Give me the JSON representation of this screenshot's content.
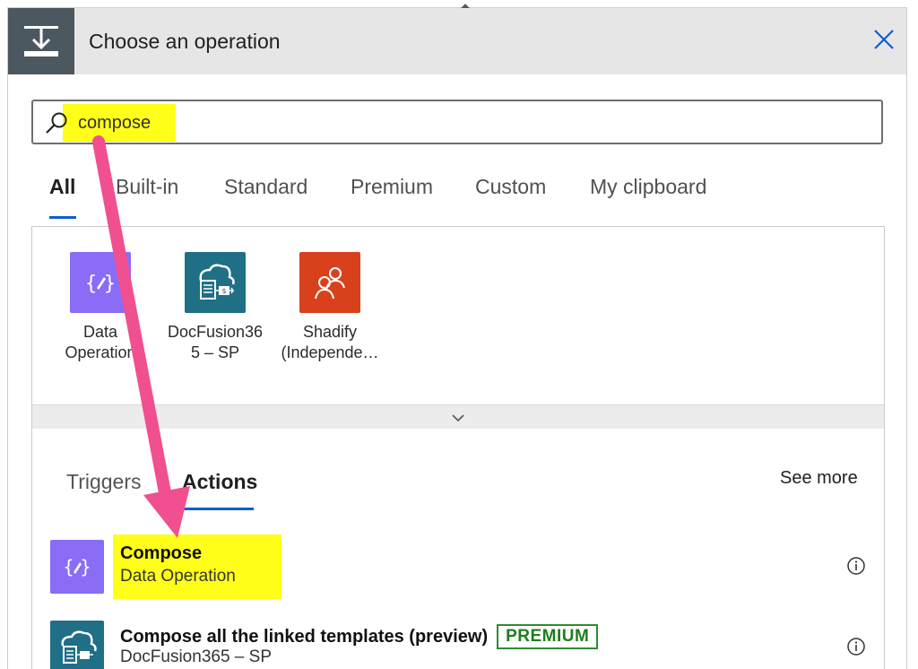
{
  "header": {
    "title": "Choose an operation",
    "close_label": "×"
  },
  "search": {
    "value": "compose",
    "highlight_color": "#ffff1a"
  },
  "tabs": [
    {
      "label": "All",
      "active": true
    },
    {
      "label": "Built-in",
      "active": false
    },
    {
      "label": "Standard",
      "active": false
    },
    {
      "label": "Premium",
      "active": false
    },
    {
      "label": "Custom",
      "active": false
    },
    {
      "label": "My clipboard",
      "active": false
    }
  ],
  "connectors": [
    {
      "line1": "Data",
      "line2": "Operation",
      "color": "#8a6cf7",
      "icon": "curly-pencil-icon"
    },
    {
      "line1": "DocFusion36",
      "line2": "5 – SP",
      "color": "#1f6f87",
      "icon": "cloud-document-icon"
    },
    {
      "line1": "Shadify",
      "line2": "(Independe…",
      "color": "#d9411c",
      "icon": "people-icon"
    }
  ],
  "subtabs": {
    "triggers": "Triggers",
    "actions": "Actions",
    "see_more": "See more"
  },
  "results": [
    {
      "title": "Compose",
      "subtitle": "Data Operation",
      "color": "#8a6cf7",
      "icon": "curly-pencil-icon",
      "premium": false
    },
    {
      "title": "Compose all the linked templates (preview)",
      "subtitle": "DocFusion365 – SP",
      "color": "#1f6f87",
      "icon": "cloud-document-icon",
      "premium": true,
      "badge": "PREMIUM"
    }
  ],
  "colors": {
    "accent": "#0b5fd3",
    "annotation_arrow": "#f0508f",
    "header_bg": "#e6e6e6",
    "header_icon_bg": "#4c5860"
  }
}
